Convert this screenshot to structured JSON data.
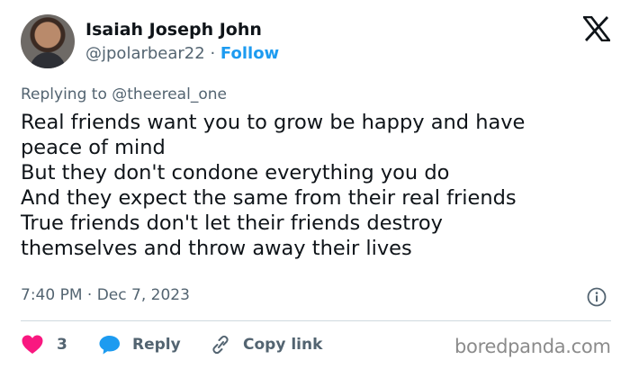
{
  "author": {
    "name": "Isaiah Joseph John",
    "handle": "@jpolarbear22",
    "separator": "·",
    "follow_label": "Follow"
  },
  "brand_icon": "x-logo-icon",
  "reply_context": {
    "prefix": "Replying to",
    "mention": "@theereal_one"
  },
  "tweet": {
    "lines": [
      "Real friends want you to grow be happy and have",
      "peace of mind",
      "But they don't condone everything you do",
      "And they expect the same from their real friends",
      "True friends don't let their friends destroy",
      "themselves and throw away their lives"
    ],
    "time": "7:40 PM",
    "separator": "·",
    "date": "Dec 7, 2023"
  },
  "actions": {
    "like_count": "3",
    "reply_label": "Reply",
    "copy_link_label": "Copy link"
  },
  "watermark": "boredpanda.com",
  "colors": {
    "text": "#0f1419",
    "secondary": "#536471",
    "link": "#1d9bf0",
    "like": "#f91880",
    "divider": "#cfd9de"
  }
}
